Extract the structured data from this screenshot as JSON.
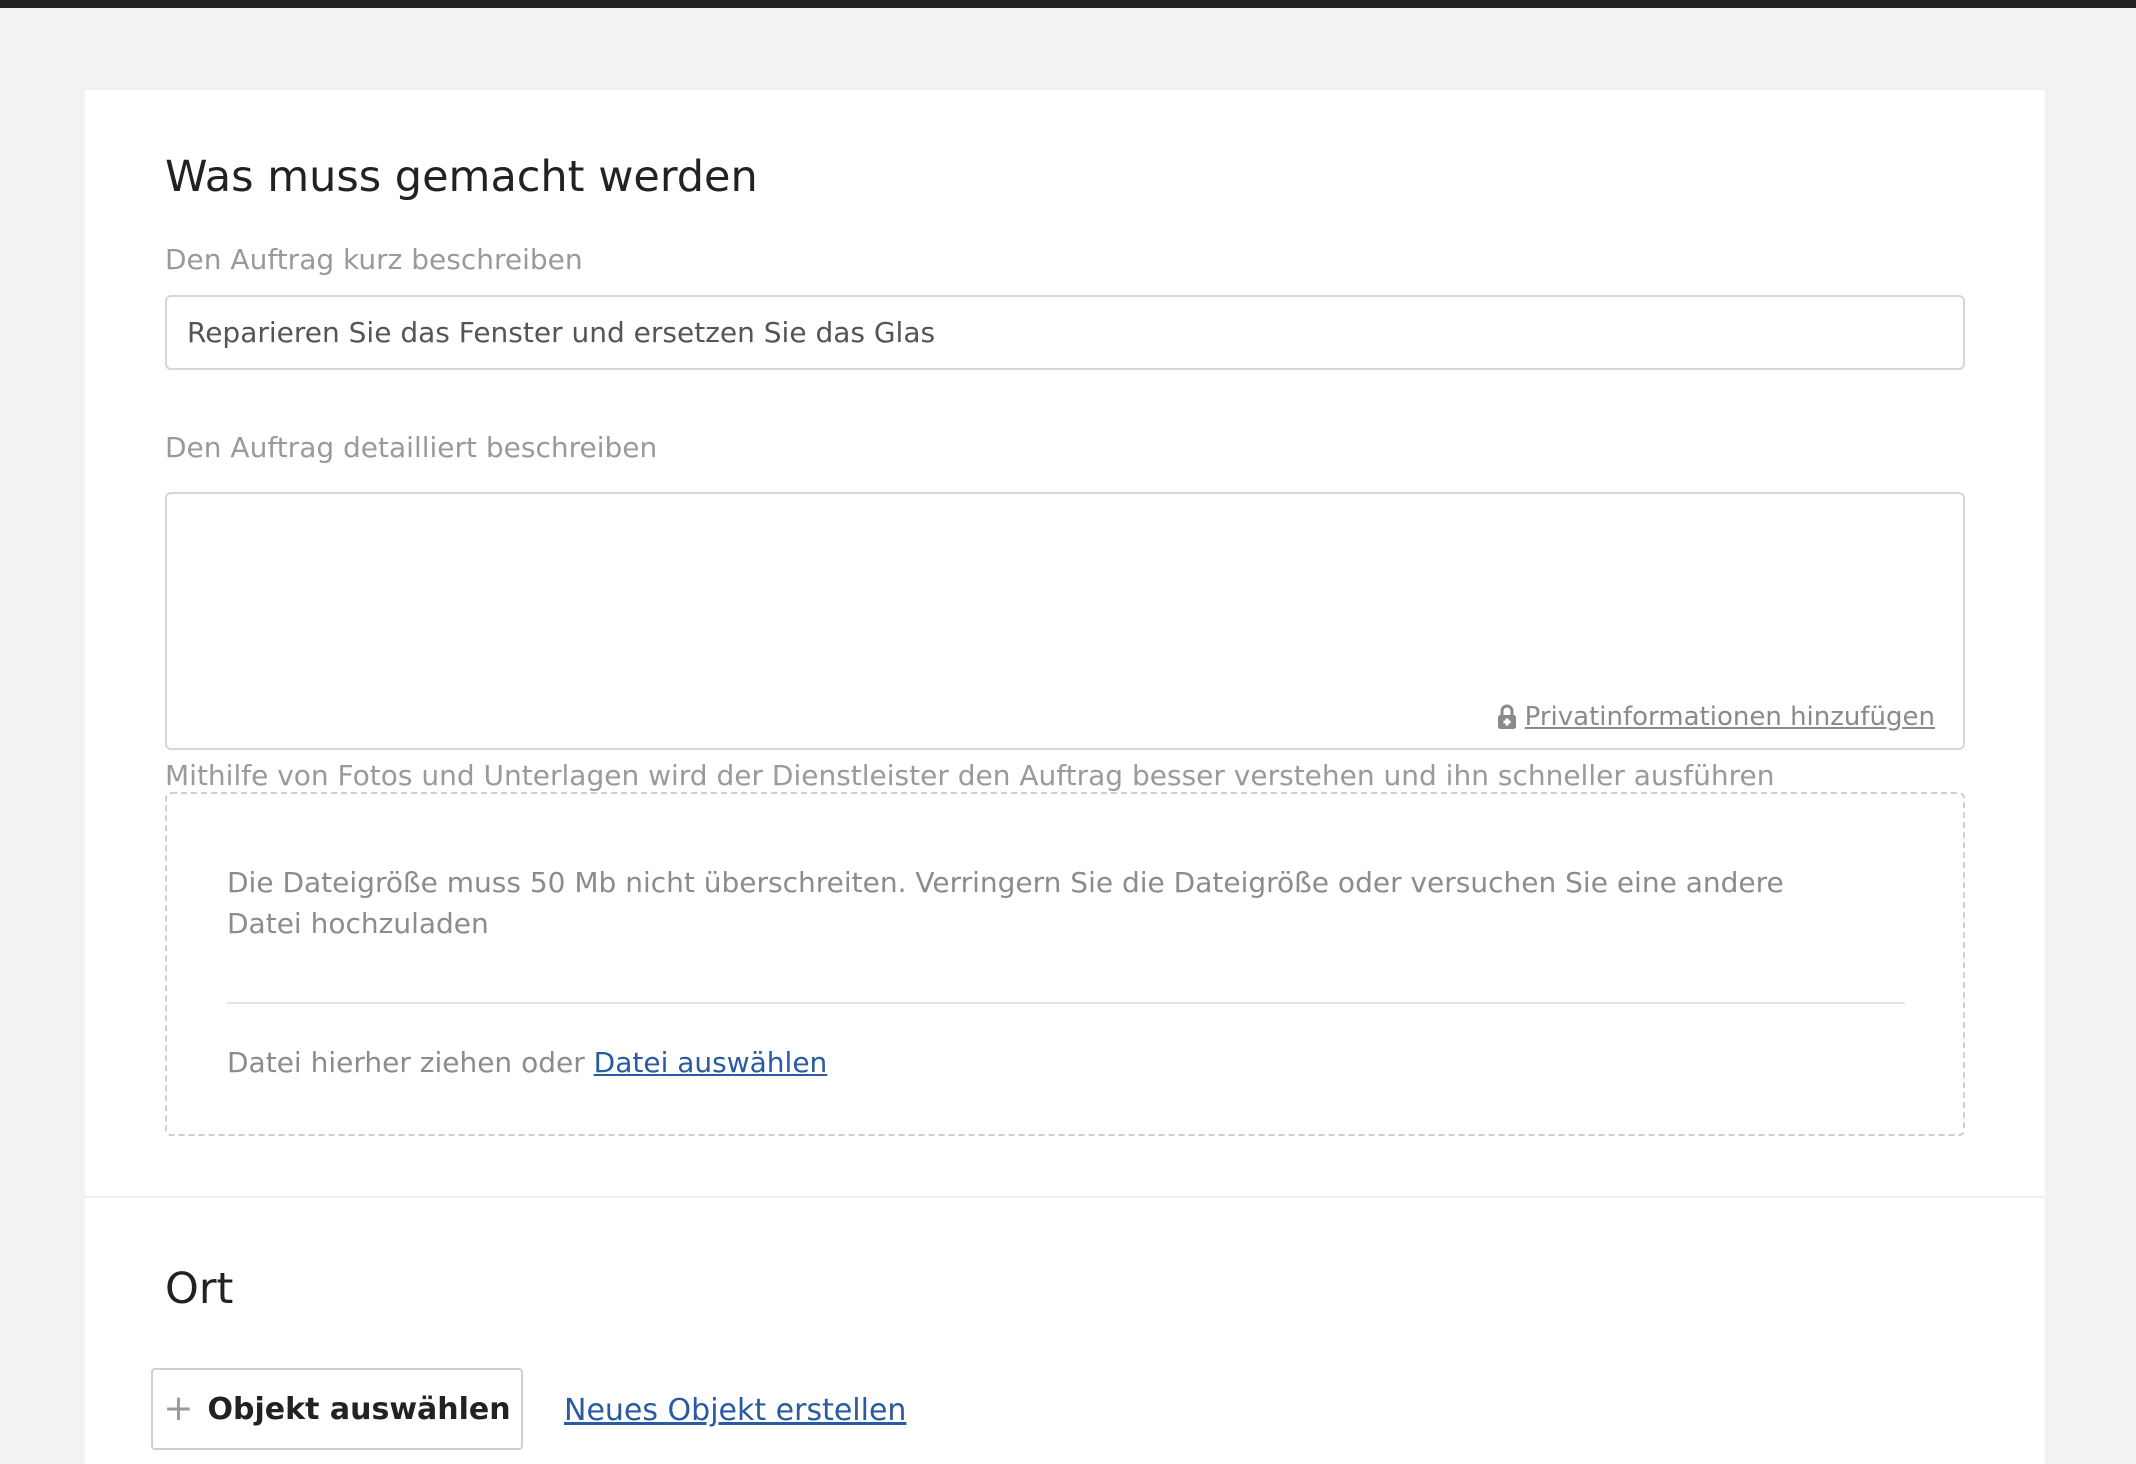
{
  "sections": {
    "task": {
      "title": "Was muss gemacht werden",
      "short_label": "Den Auftrag kurz beschreiben",
      "short_value": "Reparieren Sie das Fenster und ersetzen Sie das Glas",
      "detail_label": "Den Auftrag detailliert beschreiben",
      "detail_value": "",
      "private_link": "Privatinformationen hinzufügen",
      "attachments_hint": "Mithilfe von Fotos und Unterlagen wird der Dienstleister den Auftrag besser verstehen und ihn schneller ausführen",
      "upload_error": "Die Dateigröße muss 50 Mb nicht überschreiten. Verringern Sie die Dateigröße oder versuchen Sie eine andere Datei hochzuladen",
      "drop_text": "Datei hierher ziehen oder",
      "choose_file_link": "Datei auswählen"
    },
    "location": {
      "title": "Ort",
      "select_object_button": "Objekt auswählen",
      "new_object_link": "Neues Objekt erstellen"
    }
  },
  "icons": {
    "lock": "lock-icon",
    "plus": "plus-icon"
  },
  "colors": {
    "link": "#2a5aa0",
    "background": "#f2f2f2",
    "topbar": "#222222"
  }
}
